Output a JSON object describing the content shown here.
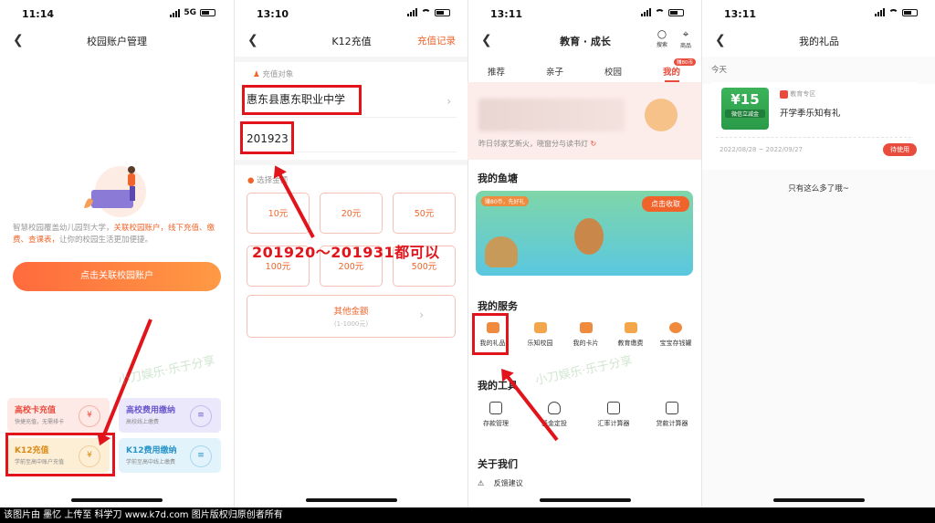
{
  "panels": {
    "p1": {
      "time": "11:14",
      "network": "5G",
      "title": "校园账户管理",
      "desc_pre": "智慧校园覆盖幼儿园到大学，",
      "desc_hl": "关联校园账户，线下充值、缴费、查课表，",
      "desc_post": "让你的校园生活更加便捷。",
      "button": "点击关联校园账户",
      "cards": [
        {
          "title": "高校卡充值",
          "sub": "快捷充值，无需排卡"
        },
        {
          "title": "高校费用缴纳",
          "sub": "高校线上缴费"
        },
        {
          "title": "K12充值",
          "sub": "学前至高中账户充值"
        },
        {
          "title": "K12费用缴纳",
          "sub": "学前至高中线上缴费"
        }
      ]
    },
    "p2": {
      "time": "13:10",
      "title": "K12充值",
      "record_link": "充值记录",
      "target_label": "充值对象",
      "school": "惠东县惠东职业中学",
      "student_id": "201923",
      "amount_label": "选择金额",
      "amounts": [
        "10元",
        "20元",
        "50元",
        "100元",
        "200元",
        "500元"
      ],
      "other_amount": "其他金额",
      "other_range": "(1-1000元)",
      "annotation": "201920～201931都可以"
    },
    "p3": {
      "time": "13:11",
      "title": "教育 · 成长",
      "search": "搜索",
      "store": "商品",
      "badge": "赚80币",
      "tabs": [
        "推荐",
        "亲子",
        "校园",
        "我的"
      ],
      "hero_text": "昨日邻家艺新火，晓窗分与读书灯",
      "fish_title": "我的鱼塘",
      "fish_tag": "赚80币，先好礼",
      "fish_btn": "点击收取",
      "services_title": "我的服务",
      "services": [
        "我的礼品",
        "乐知校园",
        "我的卡片",
        "教育缴费",
        "宝宝存钱罐"
      ],
      "tools_title": "我的工具",
      "tools": [
        "存款管理",
        "基金定投",
        "汇率计算器",
        "贷款计算器"
      ],
      "about_title": "关于我们",
      "feedback": "反馈建议"
    },
    "p4": {
      "time": "13:11",
      "title": "我的礼品",
      "today": "今天",
      "gift_zone": "教育专区",
      "gift_value": "¥15",
      "gift_cash": "微信立减金",
      "gift_name": "开学季乐知有礼",
      "gift_date": "2022/08/28 ~ 2022/09/27",
      "gift_status": "待使用",
      "end_text": "只有这么多了哦~"
    }
  },
  "watermark": "小刀娱乐·乐于分享",
  "footer": "该图片由 墨忆 上传至 科学刀 www.k7d.com 图片版权归原创者所有",
  "colors": {
    "accent": "#f0642c",
    "annotation_red": "#e1131b",
    "brand_red": "#e84c3d"
  }
}
